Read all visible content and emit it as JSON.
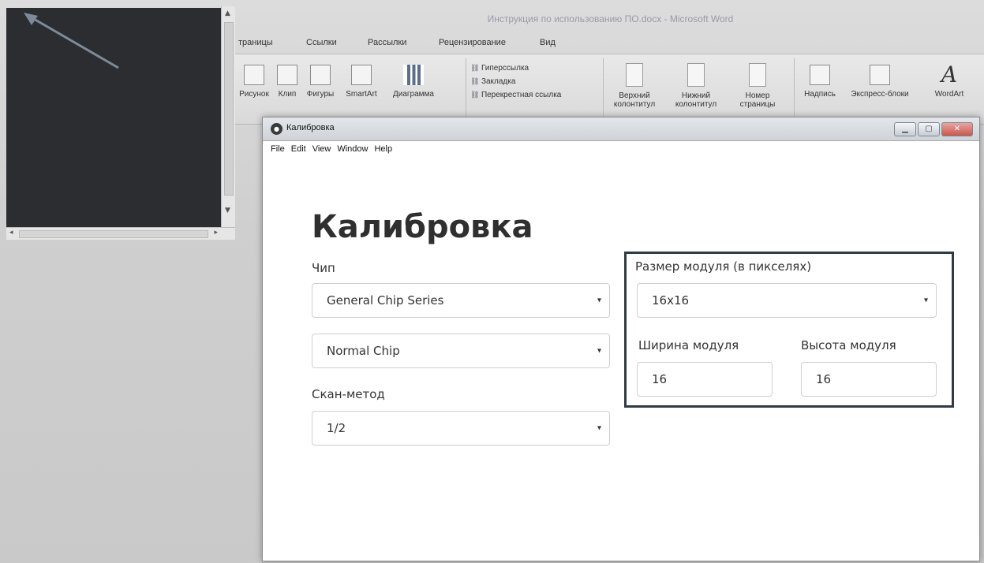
{
  "background_word": {
    "title": "Инструкция по использованию ПО.docx - Microsoft Word",
    "tabs": [
      "траницы",
      "Ссылки",
      "Рассылки",
      "Рецензирование",
      "Вид"
    ],
    "ribbon": {
      "insert_buttons": [
        "Рисунок",
        "Клип",
        "Фигуры",
        "SmartArt",
        "Диаграмма"
      ],
      "links": [
        "Гиперссылка",
        "Закладка",
        "Перекрестная ссылка"
      ],
      "header_footer": [
        "Верхний колонтитул",
        "Нижний колонтитул",
        "Номер страницы"
      ],
      "text_buttons": [
        "Надпись",
        "Экспресс-блоки",
        "WordArt"
      ]
    }
  },
  "window": {
    "title": "Калибровка",
    "menu": [
      "File",
      "Edit",
      "View",
      "Window",
      "Help"
    ]
  },
  "page": {
    "title": "Калибровка"
  },
  "chip": {
    "label": "Чип",
    "series_value": "General Chip Series",
    "type_value": "Normal Chip"
  },
  "scan": {
    "label": "Скан-метод",
    "value": "1/2"
  },
  "module": {
    "size_label": "Размер модуля (в пикселях)",
    "size_value": "16x16",
    "width_label": "Ширина модуля",
    "width_value": "16",
    "height_label": "Высота модуля",
    "height_value": "16"
  },
  "icons": {
    "caret": "▾",
    "minimize": "▁",
    "maximize": "▢",
    "close": "✕"
  },
  "colors": {
    "dark_panel": "#2b2d30",
    "group_border": "#2f3a44",
    "title_text": "#2f2f2f"
  }
}
